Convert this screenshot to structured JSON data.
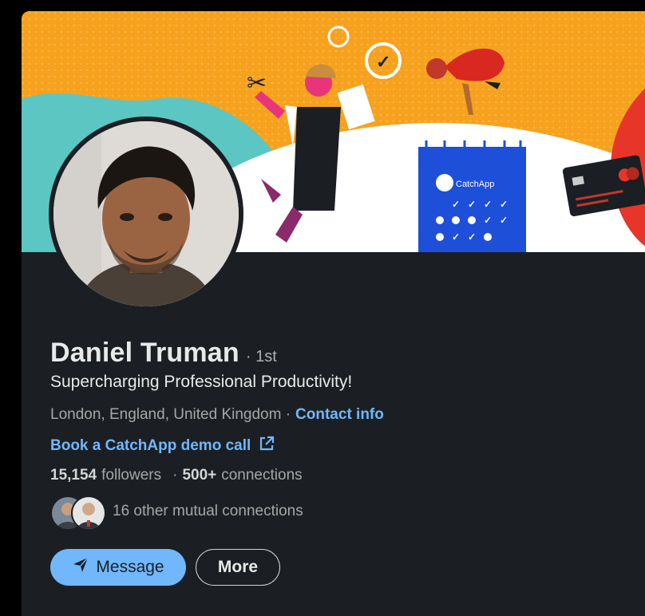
{
  "profile": {
    "name": "Daniel Truman",
    "degree": "· 1st",
    "headline": "Supercharging Professional Productivity!",
    "location": "London, England, United Kingdom ·",
    "contact_label": "Contact info",
    "link_label": "Book a CatchApp demo call",
    "followers_count": "15,154",
    "followers_label": "followers",
    "connections_sep": "·",
    "connections_count": "500+",
    "connections_label": "connections",
    "mutual_label": "16 other mutual connections"
  },
  "banner": {
    "brand_text": "CatchApp"
  },
  "actions": {
    "message_label": "Message",
    "more_label": "More"
  },
  "colors": {
    "card_bg": "#1b1f23",
    "accent": "#71b7fb",
    "banner_orange": "#f6a21e"
  }
}
